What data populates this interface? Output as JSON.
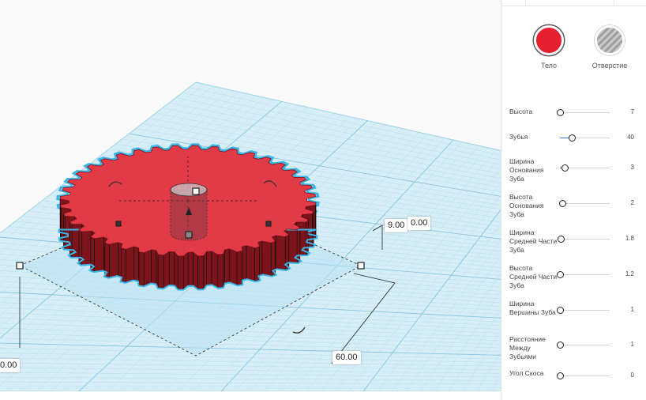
{
  "shape_type": {
    "solid": {
      "label": "Тело",
      "color": "#e5202f"
    },
    "hole": {
      "label": "Отверстие"
    }
  },
  "params": [
    {
      "label": "Высота",
      "value": "7",
      "fraction": 0.0
    },
    {
      "label": "Зубья",
      "value": "40",
      "fraction": 0.25
    },
    {
      "label": "Ширина Основания Зуба",
      "value": "3",
      "fraction": 0.1
    },
    {
      "label": "Высота Основания Зуба",
      "value": "2",
      "fraction": 0.05
    },
    {
      "label": "Ширина Средней Части Зуба",
      "value": "1.8",
      "fraction": 0.03
    },
    {
      "label": "Высота Средней Части Зуба",
      "value": "1.2",
      "fraction": 0.0
    },
    {
      "label": "Ширина Вершины Зуба",
      "value": "1",
      "fraction": 0.0
    },
    {
      "label": "Расстояние Между Зубьями",
      "value": "1",
      "fraction": 0.0
    },
    {
      "label": "Угол Скоса",
      "value": "0",
      "fraction": 0.0
    }
  ],
  "dimensions": {
    "height": "9.00",
    "elevation": "0.00",
    "width": "60.00",
    "depth": "0.00"
  },
  "colors": {
    "grid": "#9fd3e8",
    "grid_fill": "#d8eef7",
    "gear": "#e23a46",
    "gear_dark": "#9c1e26",
    "outline": "#3bb4e6",
    "slider_accent": "#3d7bd9"
  }
}
